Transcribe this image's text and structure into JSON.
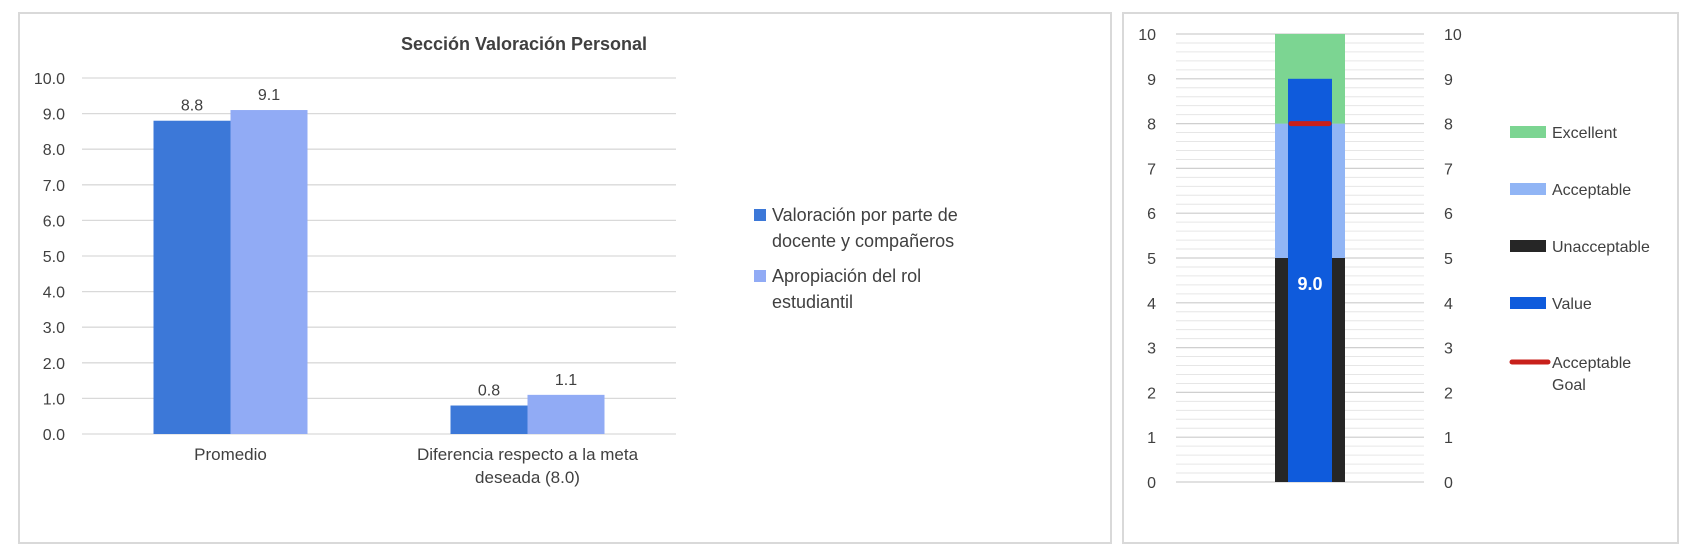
{
  "colors": {
    "series1": "#3c78d8",
    "series2": "#91abf5",
    "excellent": "#7cd592",
    "acceptable": "#91b5f5",
    "unacceptable": "#262626",
    "value": "#0f5bdc",
    "goal": "#c8201b",
    "grid": "#d9d9d9",
    "text": "#404040"
  },
  "chart_data": [
    {
      "type": "bar",
      "title": "Sección Valoración Personal",
      "categories": [
        "Promedio",
        "Diferencia respecto a la meta deseada (8.0)"
      ],
      "series": [
        {
          "name": "Valoración por parte de docente y compañeros",
          "values": [
            8.8,
            0.8
          ]
        },
        {
          "name": "Apropiación del rol estudiantil",
          "values": [
            9.1,
            1.1
          ]
        }
      ],
      "data_labels": [
        [
          "8.8",
          "0.8"
        ],
        [
          "9.1",
          "1.1"
        ]
      ],
      "ylim": [
        0,
        10
      ],
      "yticks": [
        "0.0",
        "1.0",
        "2.0",
        "3.0",
        "4.0",
        "5.0",
        "6.0",
        "7.0",
        "8.0",
        "9.0",
        "10.0"
      ],
      "grid": true,
      "legend": "right"
    },
    {
      "type": "bar",
      "subtype": "bullet",
      "ranges": [
        {
          "name": "Unacceptable",
          "from": 0,
          "to": 5
        },
        {
          "name": "Acceptable",
          "from": 5,
          "to": 8
        },
        {
          "name": "Excellent",
          "from": 8,
          "to": 10
        }
      ],
      "value": 9.0,
      "value_label": "9.0",
      "goal": 8.0,
      "ylim": [
        0,
        10
      ],
      "yticks": [
        "0",
        "1",
        "2",
        "3",
        "4",
        "5",
        "6",
        "7",
        "8",
        "9",
        "10"
      ],
      "grid": true,
      "legend": "right",
      "legend_items": [
        {
          "name": "Excellent",
          "key": "excellent",
          "marker": "box"
        },
        {
          "name": "Acceptable",
          "key": "acceptable",
          "marker": "box"
        },
        {
          "name": "Unacceptable",
          "key": "unacceptable",
          "marker": "box"
        },
        {
          "name": "Value",
          "key": "value",
          "marker": "box"
        },
        {
          "name": "Acceptable Goal",
          "key": "goal",
          "marker": "line"
        }
      ]
    }
  ]
}
